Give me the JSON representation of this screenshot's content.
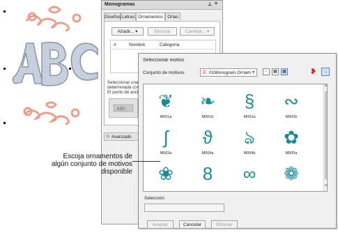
{
  "colors": {
    "embroidery_silver": "#b7c4d2",
    "embroidery_pink": "#e8a08c",
    "motif_teal": "#1a8a96",
    "dialog_bg": "#f0f0f0",
    "selected_thumb": "#cfe3ff"
  },
  "embroidery": {
    "letters": "ABC",
    "ornament_motif": "scroll"
  },
  "docker": {
    "title": "Monogramas",
    "pin_icon": "pin-icon",
    "close_icon": "close-icon",
    "tabs": [
      "Diseños",
      "Letras",
      "Ornamentos",
      "Orlas"
    ],
    "active_tab": "Ornamentos",
    "buttons": {
      "add": "Añadir...",
      "remove": "Eliminar",
      "change": "Cambiar..."
    },
    "columns": [
      "#",
      "Nombre",
      "Categoría"
    ],
    "help_lines": [
      "Seleccionar una u",
      "determinada com",
      "El punto de ancla"
    ],
    "advanced": "Avanzado"
  },
  "dialog": {
    "title": "Seleccionar motivo",
    "set_label": "Conjunto de motivos:",
    "set_value": "01Monogram Ornam",
    "selection_label": "Selección:",
    "selection_value": "",
    "buttons": {
      "accept": "Aceptar",
      "cancel": "Cancelar",
      "delete": "Eliminar"
    },
    "motifs": [
      {
        "name": "M001a",
        "glyph": "❦"
      },
      {
        "name": "M001b",
        "glyph": "❧"
      },
      {
        "name": "M002a",
        "glyph": "§"
      },
      {
        "name": "M002b",
        "glyph": "∾"
      },
      {
        "name": "M003a",
        "glyph": "∫"
      },
      {
        "name": "M004a",
        "glyph": "ϑ"
      },
      {
        "name": "M004b",
        "glyph": "ঌ"
      },
      {
        "name": "M005a",
        "glyph": "✿"
      },
      {
        "name": "",
        "glyph": "❀"
      },
      {
        "name": "",
        "glyph": "8"
      },
      {
        "name": "",
        "glyph": "∞"
      },
      {
        "name": "",
        "glyph": "❁"
      }
    ]
  },
  "callout": {
    "text": "Escoja ornamentos de algún conjunto de motivos disponible"
  }
}
